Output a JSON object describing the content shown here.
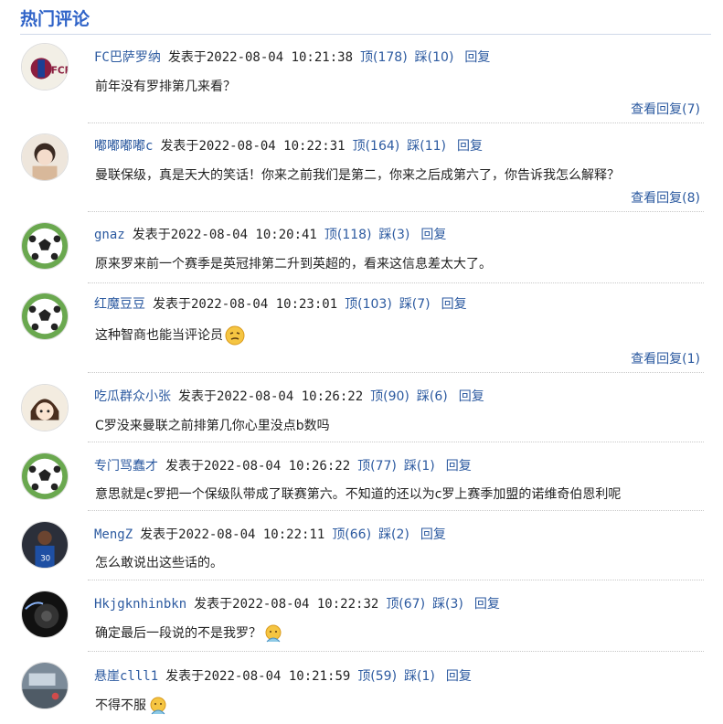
{
  "header": {
    "title": "热门评论"
  },
  "labels": {
    "posted_prefix": "发表于",
    "reply": "回复"
  },
  "comments": [
    {
      "user": "FC巴萨罗纳",
      "time": "2022-08-04 10:21:38",
      "up": "顶(178)",
      "down": "踩(10)",
      "text": "前年没有罗排第几来看？",
      "view_replies": "查看回复(7)"
    },
    {
      "user": "嘟嘟嘟嘟c",
      "time": "2022-08-04 10:22:31",
      "up": "顶(164)",
      "down": "踩(11)",
      "text": "曼联保级，真是天大的笑话！你来之前我们是第二，你来之后成第六了，你告诉我怎么解释？",
      "view_replies": "查看回复(8)"
    },
    {
      "user": "gnaz",
      "time": "2022-08-04 10:20:41",
      "up": "顶(118)",
      "down": "踩(3)",
      "text": "原来罗来前一个赛季是英冠排第二升到英超的，看来这信息差太大了。",
      "view_replies": ""
    },
    {
      "user": "红魔豆豆",
      "time": "2022-08-04 10:23:01",
      "up": "顶(103)",
      "down": "踩(7)",
      "text": "这种智商也能当评论员",
      "view_replies": "查看回复(1)"
    },
    {
      "user": "吃瓜群众小张",
      "time": "2022-08-04 10:26:22",
      "up": "顶(90)",
      "down": "踩(6)",
      "text": "C罗没来曼联之前排第几你心里没点b数吗",
      "view_replies": ""
    },
    {
      "user": "专门骂蠢才",
      "time": "2022-08-04 10:26:22",
      "up": "顶(77)",
      "down": "踩(1)",
      "text": "意思就是c罗把一个保级队带成了联赛第六。不知道的还以为c罗上赛季加盟的诺维奇伯恩利呢",
      "view_replies": ""
    },
    {
      "user": "MengZ",
      "time": "2022-08-04 10:22:11",
      "up": "顶(66)",
      "down": "踩(2)",
      "text": "怎么敢说出这些话的。",
      "view_replies": ""
    },
    {
      "user": "Hkjgknhinbkn",
      "time": "2022-08-04 10:22:32",
      "up": "顶(67)",
      "down": "踩(3)",
      "text": "确定最后一段说的不是我罗？",
      "view_replies": ""
    },
    {
      "user": "悬崖clll1",
      "time": "2022-08-04 10:21:59",
      "up": "顶(59)",
      "down": "踩(1)",
      "text": "不得不服",
      "view_replies": ""
    }
  ]
}
